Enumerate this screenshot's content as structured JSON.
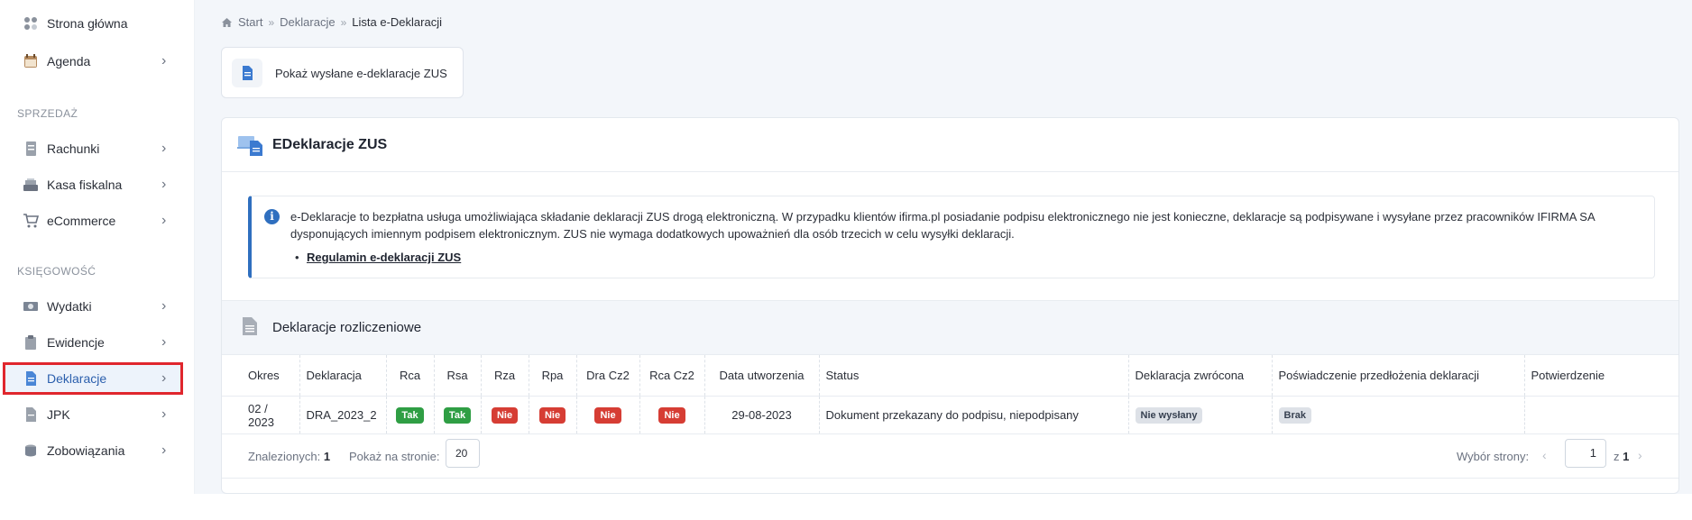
{
  "sidebar": {
    "items": [
      {
        "label": "Strona główna",
        "icon": "dashboard-icon"
      },
      {
        "label": "Agenda",
        "icon": "calendar-icon"
      },
      {
        "label": "Rachunki",
        "icon": "receipt-icon"
      },
      {
        "label": "Kasa fiskalna",
        "icon": "cash-register-icon"
      },
      {
        "label": "eCommerce",
        "icon": "cart-icon"
      },
      {
        "label": "Wydatki",
        "icon": "money-icon"
      },
      {
        "label": "Ewidencje",
        "icon": "clipboard-icon"
      },
      {
        "label": "Deklaracje",
        "icon": "document-icon"
      },
      {
        "label": "JPK",
        "icon": "jpk-icon"
      },
      {
        "label": "Zobowiązania",
        "icon": "coins-icon"
      }
    ],
    "sections": [
      "SPRZEDAŻ",
      "KSIĘGOWOŚĆ"
    ],
    "active_item": "Deklaracje"
  },
  "breadcrumb": {
    "home": "Start",
    "level1": "Deklaracje",
    "current": "Lista e-Deklaracji"
  },
  "sent_button": {
    "label": "Pokaż wysłane e-deklaracje ZUS"
  },
  "card": {
    "title": "EDeklaracje ZUS",
    "info_text": "e-Deklaracje to bezpłatna usługa umożliwiająca składanie deklaracji ZUS drogą elektroniczną. W przypadku klientów ifirma.pl posiadanie podpisu elektronicznego nie jest konieczne, deklaracje są podpisywane i wysyłane przez pracowników IFIRMA SA dysponujących imiennym podpisem elektronicznym. ZUS nie wymaga dodatkowych upoważnień dla osób trzecich w celu wysyłki deklaracji.",
    "info_link": "Regulamin e-deklaracji ZUS",
    "subtitle": "Deklaracje rozliczeniowe"
  },
  "table": {
    "headers": [
      "Okres",
      "Deklaracja",
      "Rca",
      "Rsa",
      "Rza",
      "Rpa",
      "Dra Cz2",
      "Rca Cz2",
      "Data utworzenia",
      "Status",
      "Deklaracja zwrócona",
      "Poświadczenie przedłożenia deklaracji",
      "Potwierdzenie"
    ],
    "row": {
      "okres": "02 / 2023",
      "deklaracja": "DRA_2023_2",
      "rca": "Tak",
      "rsa": "Tak",
      "rza": "Nie",
      "rpa": "Nie",
      "dra_cz2": "Nie",
      "rca_cz2": "Nie",
      "data": "29-08-2023",
      "status": "Dokument przekazany do podpisu, niepodpisany",
      "zwrocona": "Nie wysłany",
      "poswiadczenie": "Brak",
      "potwierdzenie": ""
    }
  },
  "footer": {
    "found_label": "Znalezionych:",
    "found_count": "1",
    "per_page_label": "Pokaż na stronie:",
    "per_page_value": "20",
    "page_label": "Wybór strony:",
    "page_value": "1",
    "page_of": "z",
    "page_total": "1"
  },
  "colors": {
    "accent": "#2f6fbf",
    "success": "#2f9e44",
    "danger": "#d63d34",
    "active_border": "#e0262d"
  }
}
